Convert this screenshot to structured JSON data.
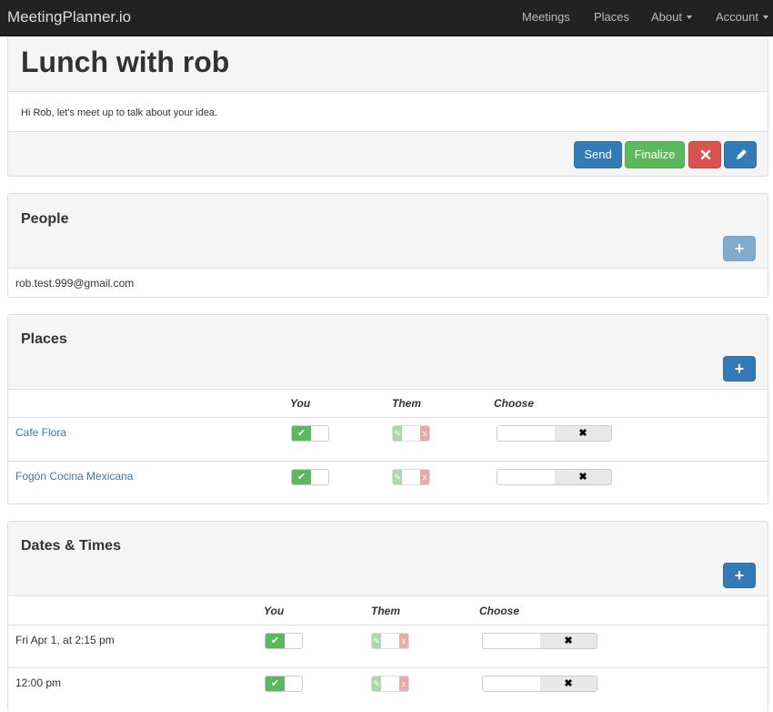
{
  "navbar": {
    "brand": "MeetingPlanner.io",
    "items": [
      "Meetings",
      "Places",
      "About",
      "Account"
    ]
  },
  "meeting": {
    "title": "Lunch with rob",
    "message": "Hi Rob, let's meet up to talk about your idea.",
    "buttons": {
      "send": "Send",
      "finalize": "Finalize",
      "cancel_icon": "x-icon",
      "edit_icon": "pencil-icon"
    }
  },
  "people": {
    "title": "People",
    "add_icon": "plus-icon",
    "list": [
      "rob.test.999@gmail.com"
    ]
  },
  "places": {
    "title": "Places",
    "add_icon": "plus-icon",
    "columns": [
      "You",
      "Them",
      "Choose"
    ],
    "rows": [
      "Cafe Flora",
      "Fogón Cocina Mexicana"
    ]
  },
  "dates": {
    "title": "Dates & Times",
    "add_icon": "plus-icon",
    "columns": [
      "You",
      "Them",
      "Choose"
    ],
    "rows": [
      "Fri Apr 1, at 2:15 pm",
      "12:00 pm"
    ]
  },
  "colors": {
    "navbar": "#222222",
    "primary": "#337ab7",
    "success": "#5cb85c",
    "danger": "#d9534f"
  }
}
